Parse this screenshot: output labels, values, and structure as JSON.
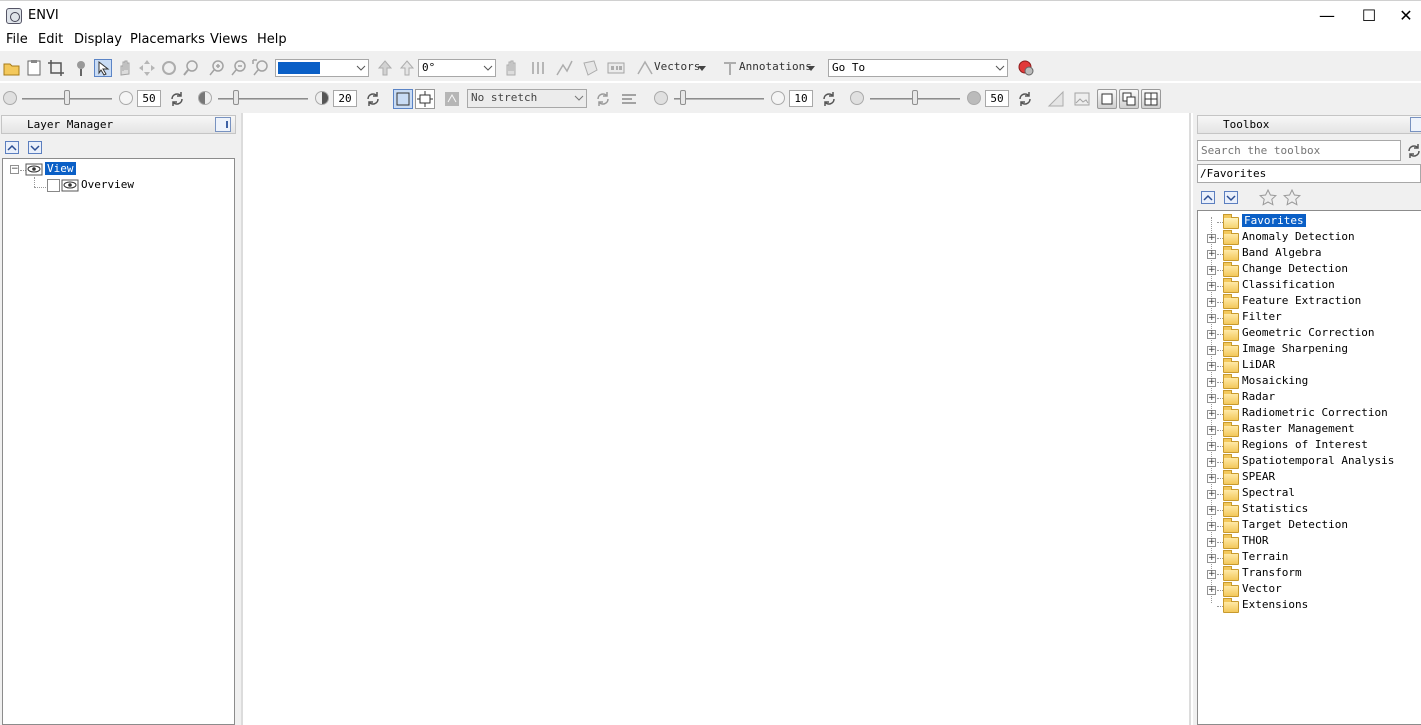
{
  "window": {
    "title": "ENVI",
    "minimize": "—",
    "maximize": "☐",
    "close": "✕"
  },
  "menu": [
    "File",
    "Edit",
    "Display",
    "Placemarks",
    "Views",
    "Help"
  ],
  "toolbar1": {
    "rotation_value": "0°",
    "vectors_label": "Vectors",
    "annotations_label": "Annotations",
    "goto_value": "Go To"
  },
  "toolbar2": {
    "brightness_value": "50",
    "contrast_value": "20",
    "stretch_value": "No stretch",
    "sharpen_value": "10",
    "transparency_value": "50"
  },
  "layer_manager": {
    "title": "Layer Manager",
    "items": [
      {
        "label": "View",
        "selected": true
      },
      {
        "label": "Overview",
        "selected": false
      }
    ]
  },
  "toolbox": {
    "title": "Toolbox",
    "search_placeholder": "Search the toolbox",
    "path": "/Favorites",
    "items": [
      "Favorites",
      "Anomaly Detection",
      "Band Algebra",
      "Change Detection",
      "Classification",
      "Feature Extraction",
      "Filter",
      "Geometric Correction",
      "Image Sharpening",
      "LiDAR",
      "Mosaicking",
      "Radar",
      "Radiometric Correction",
      "Raster Management",
      "Regions of Interest",
      "Spatiotemporal Analysis",
      "SPEAR",
      "Spectral",
      "Statistics",
      "Target Detection",
      "THOR",
      "Terrain",
      "Transform",
      "Vector",
      "Extensions"
    ]
  },
  "colors": {
    "selection": "#0a5fc6",
    "toolbar_bg": "#f0f0f0"
  }
}
